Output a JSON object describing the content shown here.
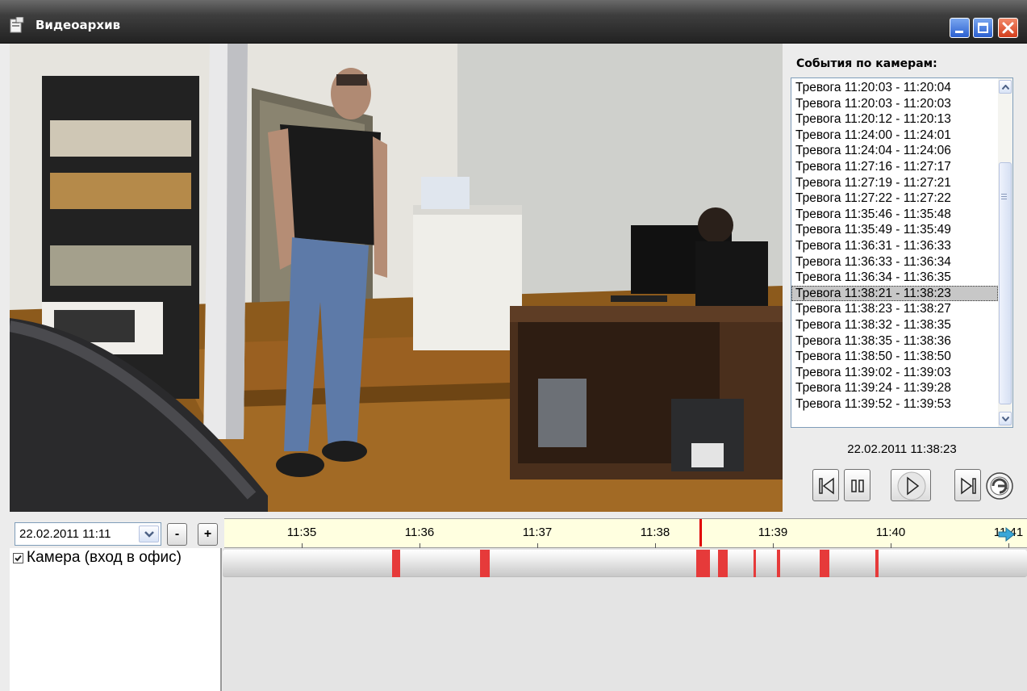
{
  "window": {
    "title": "Видеоархив",
    "accent_color": "#2b5fd0",
    "close_color": "#d43d1b"
  },
  "events_panel": {
    "title": "События по камерам:",
    "items": [
      "Тревога 11:20:03 - 11:20:04",
      "Тревога 11:20:03 - 11:20:03",
      "Тревога 11:20:12 - 11:20:13",
      "Тревога 11:24:00 - 11:24:01",
      "Тревога 11:24:04 - 11:24:06",
      "Тревога 11:27:16 - 11:27:17",
      "Тревога 11:27:19 - 11:27:21",
      "Тревога 11:27:22 - 11:27:22",
      "Тревога 11:35:46 - 11:35:48",
      "Тревога 11:35:49 - 11:35:49",
      "Тревога 11:36:31 - 11:36:33",
      "Тревога 11:36:33 - 11:36:34",
      "Тревога 11:36:34 - 11:36:35",
      "Тревога 11:38:21 - 11:38:23",
      "Тревога 11:38:23 - 11:38:27",
      "Тревога 11:38:32 - 11:38:35",
      "Тревога 11:38:35 - 11:38:36",
      "Тревога 11:38:50 - 11:38:50",
      "Тревога 11:39:02 - 11:39:03",
      "Тревога 11:39:24 - 11:39:28",
      "Тревога 11:39:52 - 11:39:53"
    ],
    "selected_index": 13
  },
  "playback": {
    "current_time": "22.02.2011 11:38:23",
    "buttons": [
      "first-frame",
      "pause",
      "play",
      "last-frame",
      "loop"
    ]
  },
  "timeline": {
    "date_value": "22.02.2011 11:11",
    "zoom_out_label": "-",
    "zoom_in_label": "+",
    "ticks": [
      "11:35",
      "11:36",
      "11:37",
      "11:38",
      "11:39",
      "11:40",
      "11:41"
    ],
    "cursor_time": "11:38:23",
    "event_color": "#e63a3a",
    "ruler_color": "#ffffe0"
  },
  "camera": {
    "checked": true,
    "label": "Камера (вход в офис)"
  }
}
